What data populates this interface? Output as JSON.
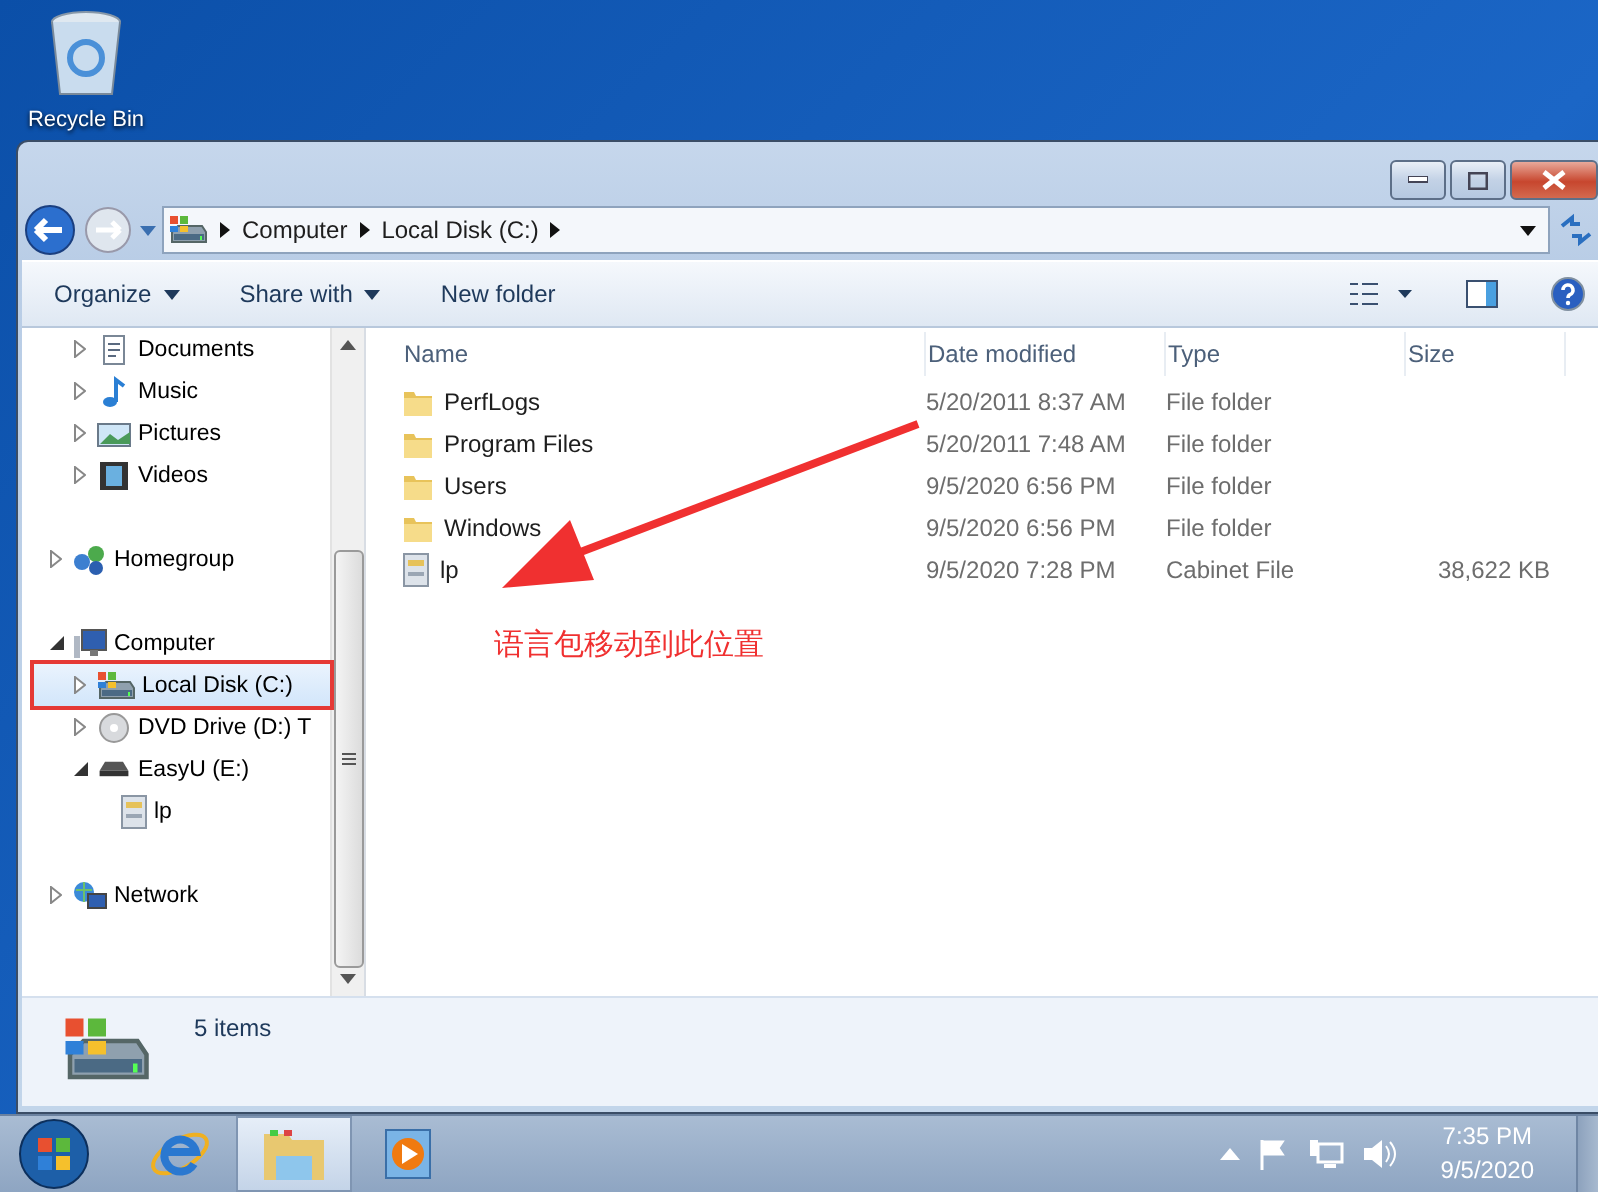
{
  "desktop": {
    "icons": [
      {
        "label": "Recycle Bin"
      }
    ]
  },
  "address_bar": {
    "crumbs": [
      "Computer",
      "Local Disk (C:)"
    ]
  },
  "toolbar": {
    "buttons": [
      {
        "label": "Organize",
        "dropdown": true
      },
      {
        "label": "Share with",
        "dropdown": true
      },
      {
        "label": "New folder",
        "dropdown": false
      }
    ]
  },
  "nav_pane": {
    "libraries": [
      {
        "label": "Documents",
        "kind": "document",
        "expanded": false,
        "selected": false,
        "highlighted": false
      },
      {
        "label": "Music",
        "kind": "music",
        "expanded": false,
        "selected": false,
        "highlighted": false
      },
      {
        "label": "Pictures",
        "kind": "picture",
        "expanded": false,
        "selected": false,
        "highlighted": false
      },
      {
        "label": "Videos",
        "kind": "video",
        "expanded": false,
        "selected": false,
        "highlighted": false
      }
    ],
    "tree": [
      {
        "label": "Homegroup",
        "kind": "homegroup",
        "expanded": false,
        "selected": false,
        "highlighted": false
      },
      {
        "label": "Computer",
        "kind": "computer",
        "expanded": true,
        "selected": false,
        "highlighted": false,
        "children": [
          {
            "label": "Local Disk (C:)",
            "kind": "disk",
            "expanded": false,
            "selected": true,
            "highlighted": true
          },
          {
            "label": "DVD Drive (D:) T",
            "kind": "dvd",
            "expanded": false,
            "selected": false,
            "highlighted": false
          },
          {
            "label": "EasyU (E:)",
            "kind": "usb",
            "expanded": true,
            "selected": false,
            "highlighted": false,
            "children": [
              {
                "label": "lp",
                "kind": "cabinet",
                "selected": false,
                "highlighted": false
              }
            ]
          }
        ]
      },
      {
        "label": "Network",
        "kind": "network",
        "expanded": false,
        "selected": false,
        "highlighted": false
      }
    ]
  },
  "file_list": {
    "columns": [
      "Name",
      "Date modified",
      "Type",
      "Size"
    ],
    "rows": [
      {
        "name": "PerfLogs",
        "date": "5/20/2011 8:37 AM",
        "type": "File folder",
        "size": "",
        "kind": "folder"
      },
      {
        "name": "Program Files",
        "date": "5/20/2011 7:48 AM",
        "type": "File folder",
        "size": "",
        "kind": "folder"
      },
      {
        "name": "Users",
        "date": "9/5/2020 6:56 PM",
        "type": "File folder",
        "size": "",
        "kind": "folder"
      },
      {
        "name": "Windows",
        "date": "9/5/2020 6:56 PM",
        "type": "File folder",
        "size": "",
        "kind": "folder"
      },
      {
        "name": "lp",
        "date": "9/5/2020 7:28 PM",
        "type": "Cabinet File",
        "size": "38,622 KB",
        "kind": "cabinet"
      }
    ],
    "annotation": {
      "text": "语言包移动到此位置"
    }
  },
  "status_bar": {
    "text": "5 items"
  },
  "taskbar": {
    "apps": [
      {
        "kind": "ie",
        "selected": false
      },
      {
        "kind": "explorer",
        "selected": true
      },
      {
        "kind": "media",
        "selected": false
      }
    ],
    "time": "7:35 PM",
    "date": "9/5/2020"
  }
}
